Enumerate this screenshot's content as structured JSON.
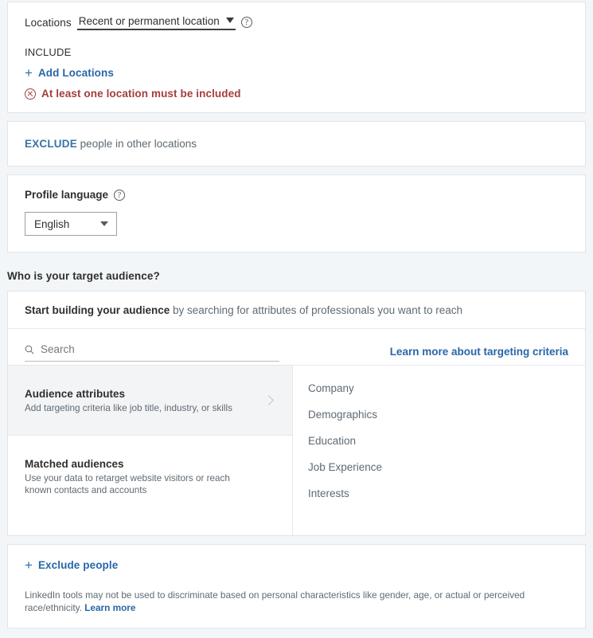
{
  "locations": {
    "label": "Locations",
    "selected_scope": "Recent or permanent location",
    "help_icon": "question-circle-icon",
    "caret_icon": "caret-down-icon",
    "include_label": "INCLUDE",
    "add_locations_label": "Add Locations",
    "add_icon": "plus-icon",
    "error_icon": "error-circle-x-icon",
    "error_message": "At least one location must be included",
    "error_color": "#a33e3e"
  },
  "exclude_locations": {
    "link_label": "EXCLUDE",
    "rest_text": " people in other locations"
  },
  "profile_language": {
    "title": "Profile language",
    "help_icon": "question-circle-icon",
    "selected": "English",
    "caret_icon": "caret-down-icon"
  },
  "audience_section": {
    "heading": "Who is your target audience?",
    "builder_head_bold": "Start building your audience",
    "builder_head_rest": " by searching for attributes of professionals you want to reach",
    "search": {
      "icon": "search-icon",
      "placeholder": "Search",
      "value": ""
    },
    "learn_more_link": "Learn more about targeting criteria",
    "left_panel": [
      {
        "title": "Audience attributes",
        "description": "Add targeting criteria like job title, industry, or skills",
        "chevron_icon": "chevron-right-icon",
        "selected": true
      },
      {
        "title": "Matched audiences",
        "description": "Use your data to retarget website visitors or reach known contacts and accounts",
        "selected": false
      }
    ],
    "right_panel_categories": [
      "Company",
      "Demographics",
      "Education",
      "Job Experience",
      "Interests"
    ]
  },
  "exclude_people": {
    "icon": "plus-icon",
    "label": "Exclude people",
    "disclaimer_text": "LinkedIn tools may not be used to discriminate based on personal characteristics like gender, age, or actual or perceived race/ethnicity. ",
    "disclaimer_link": "Learn more"
  },
  "colors": {
    "page_background": "#f3f6f8",
    "card_background": "#ffffff",
    "border": "#e1e4e8",
    "link_blue": "#2867a8",
    "error_red": "#a33e3e",
    "muted_text": "#5f6a72",
    "selected_row": "#f2f4f6"
  }
}
